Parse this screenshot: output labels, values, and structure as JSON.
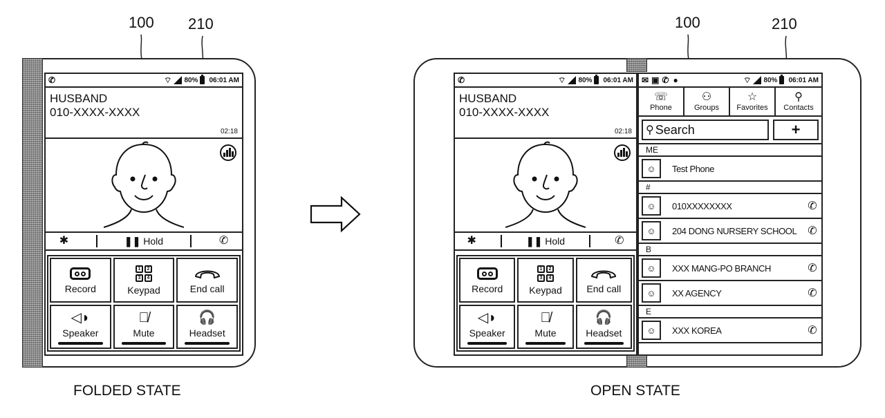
{
  "reference_labels": {
    "folded_device": "100",
    "folded_statusbar": "210",
    "open_device": "100",
    "open_statusbar": "210"
  },
  "captions": {
    "folded": "FOLDED STATE",
    "open": "OPEN STATE"
  },
  "transition_arrow": "right-arrow-icon",
  "status_bar": {
    "left_icons": [
      "phone-icon"
    ],
    "right_icons": [
      "wifi-icon",
      "signal-icon"
    ],
    "battery_percent": "80%",
    "time": "06:01 AM"
  },
  "open_right_status_bar": {
    "left_icons": [
      "message-icon",
      "gallery-icon",
      "phone-icon",
      "app-icon"
    ],
    "battery_percent": "80%",
    "time": "06:01 AM"
  },
  "call": {
    "caller_name": "HUSBAND",
    "caller_number": "010-XXXX-XXXX",
    "duration": "02:18",
    "hold_label": "Hold",
    "hold_bar_icons": [
      "bluetooth-icon",
      "pause-icon",
      "add-call-icon"
    ],
    "buttons": [
      {
        "label": "Record",
        "icon": "record-icon",
        "indicator": false
      },
      {
        "label": "Keypad",
        "icon": "keypad-icon",
        "indicator": false
      },
      {
        "label": "End call",
        "icon": "end-call-icon",
        "indicator": false
      },
      {
        "label": "Speaker",
        "icon": "speaker-icon",
        "indicator": true
      },
      {
        "label": "Mute",
        "icon": "mute-icon",
        "indicator": true
      },
      {
        "label": "Headset",
        "icon": "headset-icon",
        "indicator": true
      }
    ],
    "keypad_digits": [
      "1",
      "2",
      "3",
      "4"
    ]
  },
  "contacts_panel": {
    "tabs": [
      {
        "label": "Phone",
        "icon": "phone-tab-icon"
      },
      {
        "label": "Groups",
        "icon": "groups-icon"
      },
      {
        "label": "Favorites",
        "icon": "star-icon"
      },
      {
        "label": "Contacts",
        "icon": "contact-icon"
      }
    ],
    "search_placeholder": "Search",
    "add_label": "+",
    "sections": [
      {
        "header": "ME",
        "contacts": [
          {
            "name": "Test Phone",
            "call": false
          }
        ]
      },
      {
        "header": "#",
        "contacts": [
          {
            "name": "010XXXXXXXX",
            "call": true
          },
          {
            "name": "204 DONG NURSERY SCHOOL",
            "call": true
          }
        ]
      },
      {
        "header": "B",
        "contacts": [
          {
            "name": "XXX MANG-PO BRANCH",
            "call": true
          },
          {
            "name": "XX AGENCY",
            "call": true
          }
        ]
      },
      {
        "header": "E",
        "contacts": [
          {
            "name": "XXX KOREA",
            "call": true
          }
        ]
      }
    ]
  }
}
